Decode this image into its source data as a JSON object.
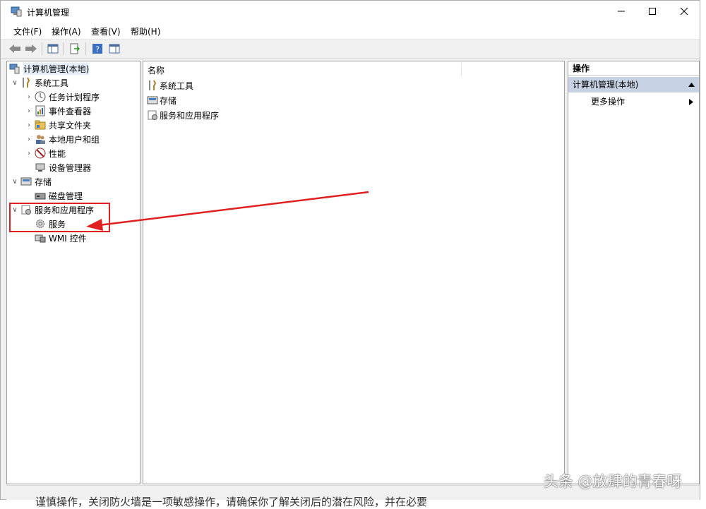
{
  "window": {
    "title": "计算机管理"
  },
  "menu": {
    "file": "文件(F)",
    "action": "操作(A)",
    "view": "查看(V)",
    "help": "帮助(H)"
  },
  "tree": {
    "root": "计算机管理(本地)",
    "system_tools": "系统工具",
    "task_scheduler": "任务计划程序",
    "event_viewer": "事件查看器",
    "shared_folders": "共享文件夹",
    "local_users": "本地用户和组",
    "performance": "性能",
    "device_manager": "设备管理器",
    "storage": "存储",
    "disk_management": "磁盘管理",
    "services_apps": "服务和应用程序",
    "services": "服务",
    "wmi": "WMI 控件"
  },
  "list": {
    "column_name": "名称",
    "items": [
      "系统工具",
      "存储",
      "服务和应用程序"
    ]
  },
  "actions": {
    "header": "操作",
    "section": "计算机管理(本地)",
    "more": "更多操作"
  },
  "background": {
    "text": "谨慎操作，关闭防火墙是一项敏感操作，请确保你了解关闭后的潜在风险，并在必要",
    "watermark": "头条 @放肆的青春呀"
  },
  "colors": {
    "highlight": "#e02020",
    "selection": "#c7d3e4"
  }
}
